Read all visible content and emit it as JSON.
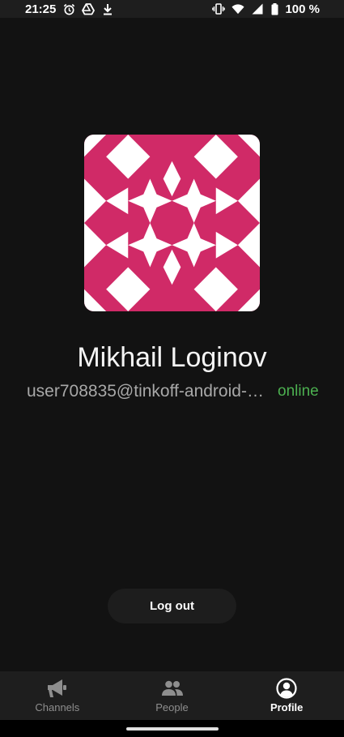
{
  "status_bar": {
    "time": "21:25",
    "battery": "100 %",
    "icons": [
      "alarm-icon",
      "drive-icon",
      "download-icon",
      "vibrate-icon",
      "wifi-icon",
      "signal-icon",
      "battery-icon"
    ]
  },
  "profile": {
    "name": "Mikhail Loginov",
    "email": "user708835@tinkoff-android-s…",
    "status": "online",
    "avatar_colors": {
      "primary": "#d02a67",
      "secondary": "#ffffff"
    }
  },
  "actions": {
    "logout_label": "Log out"
  },
  "bottom_nav": {
    "items": [
      {
        "label": "Channels",
        "icon": "megaphone-icon",
        "active": false
      },
      {
        "label": "People",
        "icon": "people-icon",
        "active": false
      },
      {
        "label": "Profile",
        "icon": "profile-icon",
        "active": true
      }
    ]
  },
  "colors": {
    "background": "#121212",
    "online": "#4cb050",
    "nav_background": "#1e1e1e"
  }
}
